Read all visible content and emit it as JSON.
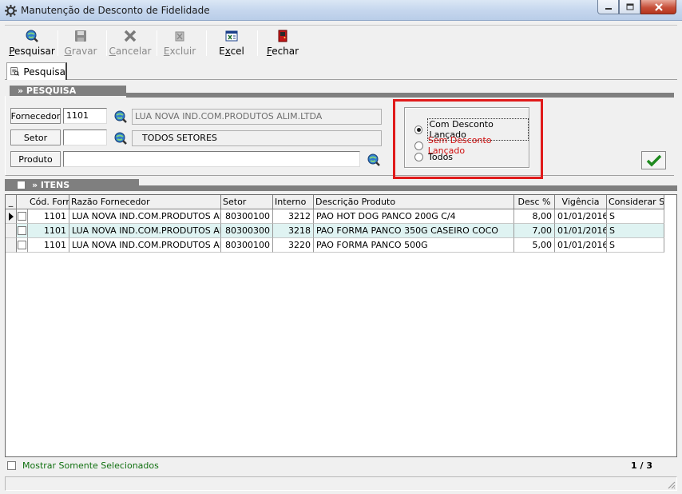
{
  "window": {
    "title": "Manutenção de Desconto de Fidelidade"
  },
  "toolbar": {
    "pesquisar": {
      "pre": "",
      "key": "P",
      "post": "esquisar",
      "icon": "search-globe-icon",
      "enabled": true
    },
    "gravar": {
      "pre": "",
      "key": "G",
      "post": "ravar",
      "icon": "floppy-disk-icon",
      "enabled": false
    },
    "cancelar": {
      "pre": "",
      "key": "C",
      "post": "ancelar",
      "icon": "cancel-x-icon",
      "enabled": false
    },
    "excluir": {
      "pre": "",
      "key": "E",
      "post": "xcluir",
      "icon": "delete-icon",
      "enabled": false
    },
    "excel": {
      "pre": "E",
      "key": "x",
      "post": "cel",
      "icon": "excel-icon",
      "enabled": true
    },
    "fechar": {
      "pre": "",
      "key": "F",
      "post": "echar",
      "icon": "exit-door-icon",
      "enabled": true
    }
  },
  "tabs": [
    {
      "label": "Pesquisa",
      "icon": "document-search-icon",
      "active": true
    }
  ],
  "pesquisa": {
    "section_title": "» PESQUISA",
    "fornecedor": {
      "label": "Fornecedor",
      "code": "1101",
      "name": "LUA NOVA IND.COM.PRODUTOS ALIM.LTDA"
    },
    "setor": {
      "label": "Setor",
      "code": "",
      "name": "TODOS SETORES"
    },
    "produto": {
      "label": "Produto",
      "value": ""
    },
    "filter_options": [
      {
        "label": "Com Desconto Lançado",
        "selected": true,
        "color": "#000000"
      },
      {
        "label": "Sem Desconto Lançado",
        "selected": false,
        "color": "#d01010"
      },
      {
        "label": "Todos",
        "selected": false,
        "color": "#000000"
      }
    ],
    "confirm_icon": "green-check-icon"
  },
  "itens": {
    "section_title": "» ITENS",
    "select_all_checked": false,
    "columns": [
      "_",
      "Cód. Forn",
      "Razão Fornecedor",
      "Setor",
      "Interno",
      "Descrição Produto",
      "Desc %",
      "Vigência",
      "Considerar ST"
    ],
    "rows": [
      {
        "checked": false,
        "cod_forn": "1101",
        "razao": "LUA NOVA IND.COM.PRODUTOS ALIM",
        "setor": "80300100",
        "interno": "3212",
        "descricao": "PAO HOT DOG PANCO 200G C/4",
        "desc": "8,00",
        "vigencia": "01/01/2016",
        "st": "S",
        "current": true
      },
      {
        "checked": false,
        "cod_forn": "1101",
        "razao": "LUA NOVA IND.COM.PRODUTOS ALIM",
        "setor": "80300300",
        "interno": "3218",
        "descricao": "PAO FORMA PANCO 350G CASEIRO COCO",
        "desc": "7,00",
        "vigencia": "01/01/2016",
        "st": "S",
        "current": false
      },
      {
        "checked": false,
        "cod_forn": "1101",
        "razao": "LUA NOVA IND.COM.PRODUTOS ALIM",
        "setor": "80300100",
        "interno": "3220",
        "descricao": "PAO FORMA PANCO 500G",
        "desc": "5,00",
        "vigencia": "01/01/2016",
        "st": "S",
        "current": false
      }
    ]
  },
  "footer": {
    "show_selected_label": "Mostrar Somente Selecionados",
    "show_selected_checked": false,
    "show_selected_color": "#107010",
    "pager": "1 / 3"
  }
}
